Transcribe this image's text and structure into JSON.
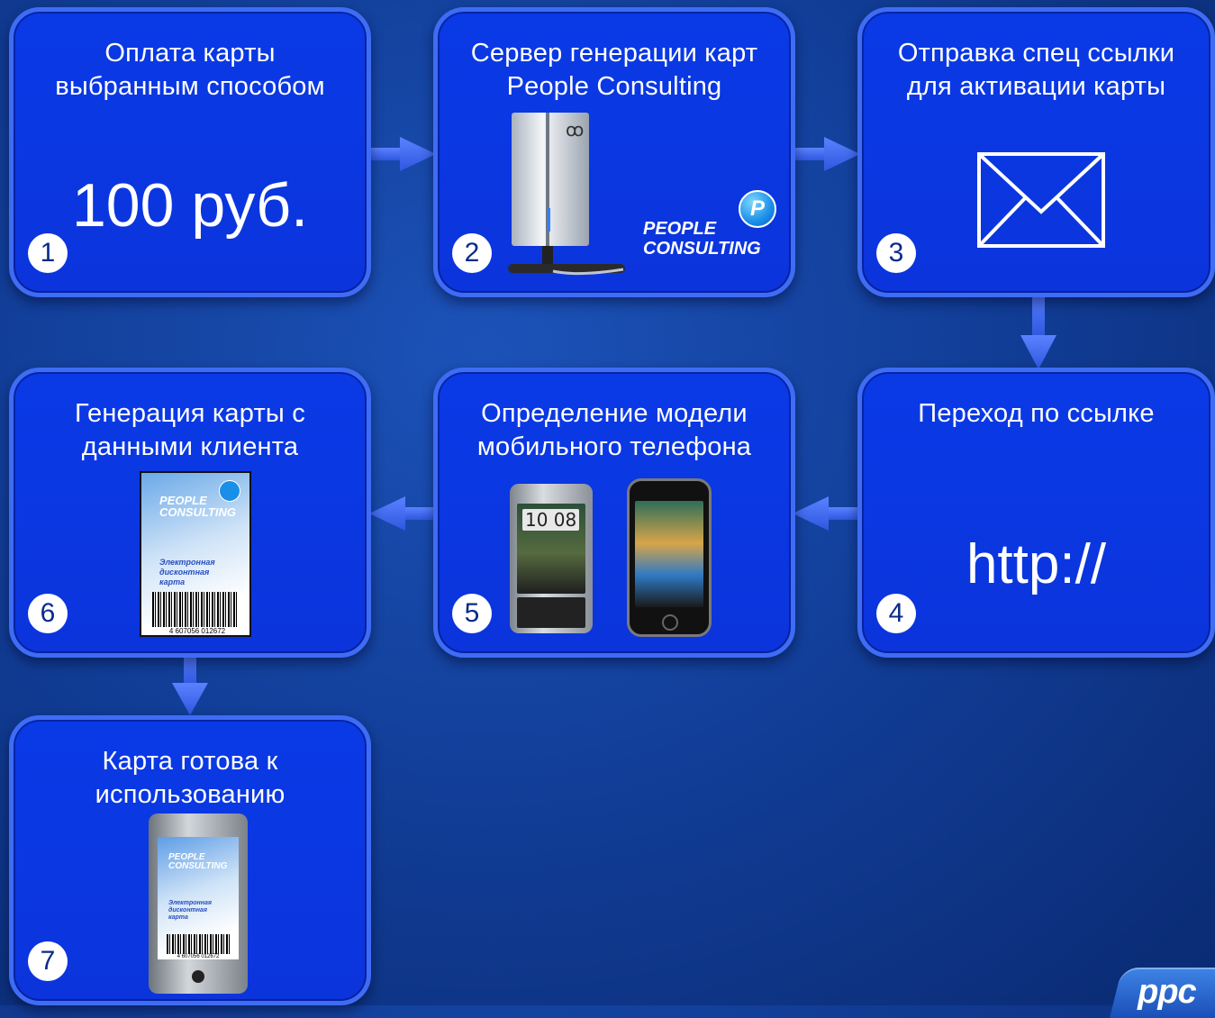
{
  "steps": [
    {
      "number": "1",
      "title": "Оплата карты\nвыбранным способом",
      "main": "100 руб."
    },
    {
      "number": "2",
      "title": "Сервер генерации карт\nPeople Consulting",
      "brand_line1": "PEOPLE",
      "brand_line2": "CONSULTING",
      "brand_badge": "P"
    },
    {
      "number": "3",
      "title": "Отправка спец ссылки\nдля активации карты"
    },
    {
      "number": "4",
      "title": "Переход по ссылке",
      "main": "http://"
    },
    {
      "number": "5",
      "title": "Определение модели\nмобильного телефона",
      "phone_time": "10 08"
    },
    {
      "number": "6",
      "title": "Генерация карты с\nданными клиента",
      "card_brand1": "PEOPLE",
      "card_brand2": "CONSULTING",
      "card_text": "Электронная\nдисконтная\nкарта",
      "barcode": "4 607056 012672"
    },
    {
      "number": "7",
      "title": "Карта готова к\nиспользованию",
      "card_brand1": "PEOPLE",
      "card_brand2": "CONSULTING",
      "card_text": "Электронная\nдисконтная\nкарта",
      "barcode": "4 607056 012672"
    }
  ],
  "corner_logo": "ppc",
  "colors": {
    "box_fill": "#0b36df",
    "box_border": "#3f6cf5",
    "arrow": "#3b66f0",
    "background": "#123f9a"
  }
}
